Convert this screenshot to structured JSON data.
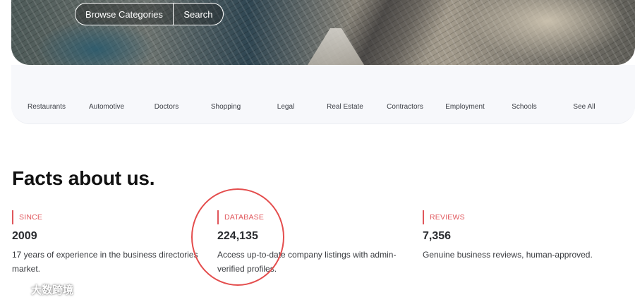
{
  "hero": {
    "browse_label": "Browse Categories",
    "search_label": "Search"
  },
  "categories": [
    "Restaurants",
    "Automotive",
    "Doctors",
    "Shopping",
    "Legal",
    "Real Estate",
    "Contractors",
    "Employment",
    "Schools",
    "See All"
  ],
  "facts": {
    "title": "Facts about us.",
    "items": [
      {
        "label": "SINCE",
        "value": "2009",
        "desc": "17 years of experience in the business directories market."
      },
      {
        "label": "DATABASE",
        "value": "224,135",
        "desc": "Access up-to-date company listings with admin-verified profiles."
      },
      {
        "label": "REVIEWS",
        "value": "7,356",
        "desc": "Genuine business reviews, human-approved."
      }
    ]
  },
  "annotation": {
    "color": "#e44d4d"
  },
  "accent_color": "#e0565b",
  "watermark": {
    "text": "大数跨境",
    "icon": "brand-logo-icon"
  }
}
